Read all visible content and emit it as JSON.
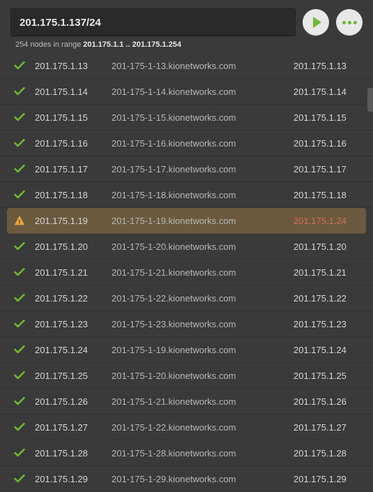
{
  "search": {
    "value": "201.175.1.137/24"
  },
  "range": {
    "prefix": "254 nodes in range ",
    "start": "201.175.1.1",
    "sep": " .. ",
    "end": "201.175.1.254"
  },
  "rows": [
    {
      "status": "ok",
      "ip": "201.175.1.13",
      "host": "201-175-1-13.kionetworks.com",
      "rip": "201.175.1.13"
    },
    {
      "status": "ok",
      "ip": "201.175.1.14",
      "host": "201-175-1-14.kionetworks.com",
      "rip": "201.175.1.14"
    },
    {
      "status": "ok",
      "ip": "201.175.1.15",
      "host": "201-175-1-15.kionetworks.com",
      "rip": "201.175.1.15"
    },
    {
      "status": "ok",
      "ip": "201.175.1.16",
      "host": "201-175-1-16.kionetworks.com",
      "rip": "201.175.1.16"
    },
    {
      "status": "ok",
      "ip": "201.175.1.17",
      "host": "201-175-1-17.kionetworks.com",
      "rip": "201.175.1.17"
    },
    {
      "status": "ok",
      "ip": "201.175.1.18",
      "host": "201-175-1-18.kionetworks.com",
      "rip": "201.175.1.18"
    },
    {
      "status": "warn",
      "ip": "201.175.1.19",
      "host": "201-175-1-19.kionetworks.com",
      "rip": "201.175.1.24"
    },
    {
      "status": "ok",
      "ip": "201.175.1.20",
      "host": "201-175-1-20.kionetworks.com",
      "rip": "201.175.1.20"
    },
    {
      "status": "ok",
      "ip": "201.175.1.21",
      "host": "201-175-1-21.kionetworks.com",
      "rip": "201.175.1.21"
    },
    {
      "status": "ok",
      "ip": "201.175.1.22",
      "host": "201-175-1-22.kionetworks.com",
      "rip": "201.175.1.22"
    },
    {
      "status": "ok",
      "ip": "201.175.1.23",
      "host": "201-175-1-23.kionetworks.com",
      "rip": "201.175.1.23"
    },
    {
      "status": "ok",
      "ip": "201.175.1.24",
      "host": "201-175-1-19.kionetworks.com",
      "rip": "201.175.1.24"
    },
    {
      "status": "ok",
      "ip": "201.175.1.25",
      "host": "201-175-1-20.kionetworks.com",
      "rip": "201.175.1.25"
    },
    {
      "status": "ok",
      "ip": "201.175.1.26",
      "host": "201-175-1-21.kionetworks.com",
      "rip": "201.175.1.26"
    },
    {
      "status": "ok",
      "ip": "201.175.1.27",
      "host": "201-175-1-22.kionetworks.com",
      "rip": "201.175.1.27"
    },
    {
      "status": "ok",
      "ip": "201.175.1.28",
      "host": "201-175-1-28.kionetworks.com",
      "rip": "201.175.1.28"
    },
    {
      "status": "ok",
      "ip": "201.175.1.29",
      "host": "201-175-1-29.kionetworks.com",
      "rip": "201.175.1.29"
    }
  ]
}
